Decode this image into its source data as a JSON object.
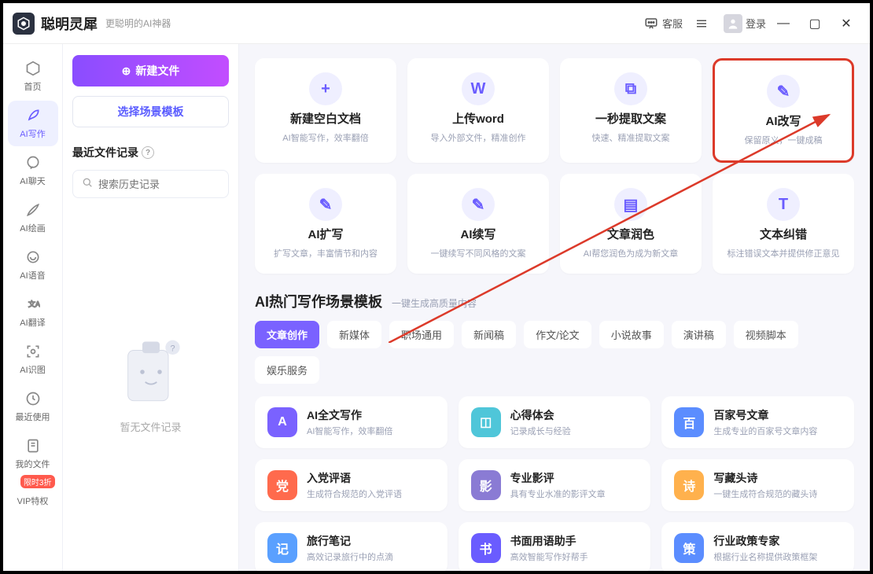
{
  "app": {
    "title": "聪明灵犀",
    "subtitle": "更聪明的AI神器"
  },
  "titlebar": {
    "support": "客服",
    "login": "登录"
  },
  "nav": {
    "items": [
      {
        "label": "首页"
      },
      {
        "label": "AI写作"
      },
      {
        "label": "AI聊天"
      },
      {
        "label": "AI绘画"
      },
      {
        "label": "AI语音"
      },
      {
        "label": "AI翻译"
      },
      {
        "label": "AI识图"
      },
      {
        "label": "最近使用"
      },
      {
        "label": "我的文件"
      },
      {
        "label": "VIP特权",
        "badge": "限时3折"
      }
    ]
  },
  "panel": {
    "new_file": "新建文件",
    "choose_template": "选择场景模板",
    "recent_title": "最近文件记录",
    "search_placeholder": "搜索历史记录",
    "empty_text": "暂无文件记录"
  },
  "feature_cards": [
    {
      "title": "新建空白文档",
      "sub": "AI智能写作，效率翻倍",
      "glyph": "+"
    },
    {
      "title": "上传word",
      "sub": "导入外部文件，精准创作",
      "glyph": "W"
    },
    {
      "title": "一秒提取文案",
      "sub": "快速、精准提取文案",
      "glyph": "⧉"
    },
    {
      "title": "AI改写",
      "sub": "保留原义，一键成稿",
      "glyph": "✎",
      "highlight": true
    },
    {
      "title": "AI扩写",
      "sub": "扩写文章，丰富情节和内容",
      "glyph": "✎"
    },
    {
      "title": "AI续写",
      "sub": "一键续写不同风格的文案",
      "glyph": "✎"
    },
    {
      "title": "文章润色",
      "sub": "AI帮您润色为成为新文章",
      "glyph": "▤"
    },
    {
      "title": "文本纠错",
      "sub": "标注错误文本并提供修正意见",
      "glyph": "T"
    }
  ],
  "section": {
    "title": "AI热门写作场景模板",
    "sub": "一键生成高质量内容"
  },
  "tabs": [
    "文章创作",
    "新媒体",
    "职场通用",
    "新闻稿",
    "作文/论文",
    "小说故事",
    "演讲稿",
    "视频脚本",
    "娱乐服务"
  ],
  "templates": [
    {
      "title": "AI全文写作",
      "sub": "AI智能写作，效率翻倍",
      "color": "#7a62ff",
      "glyph": "A"
    },
    {
      "title": "心得体会",
      "sub": "记录成长与经验",
      "color": "#4fc6d9",
      "glyph": "◫"
    },
    {
      "title": "百家号文章",
      "sub": "生成专业的百家号文章内容",
      "color": "#5b8dff",
      "glyph": "百"
    },
    {
      "title": "入党评语",
      "sub": "生成符合规范的入党评语",
      "color": "#ff6a4d",
      "glyph": "党"
    },
    {
      "title": "专业影评",
      "sub": "具有专业水准的影评文章",
      "color": "#8a7bd4",
      "glyph": "影"
    },
    {
      "title": "写藏头诗",
      "sub": "一键生成符合规范的藏头诗",
      "color": "#ffb14d",
      "glyph": "诗"
    },
    {
      "title": "旅行笔记",
      "sub": "高效记录旅行中的点滴",
      "color": "#5aa0ff",
      "glyph": "记"
    },
    {
      "title": "书面用语助手",
      "sub": "高效智能写作好帮手",
      "color": "#6a5cff",
      "glyph": "书"
    },
    {
      "title": "行业政策专家",
      "sub": "根据行业名称提供政策框架",
      "color": "#5b8dff",
      "glyph": "策"
    }
  ]
}
